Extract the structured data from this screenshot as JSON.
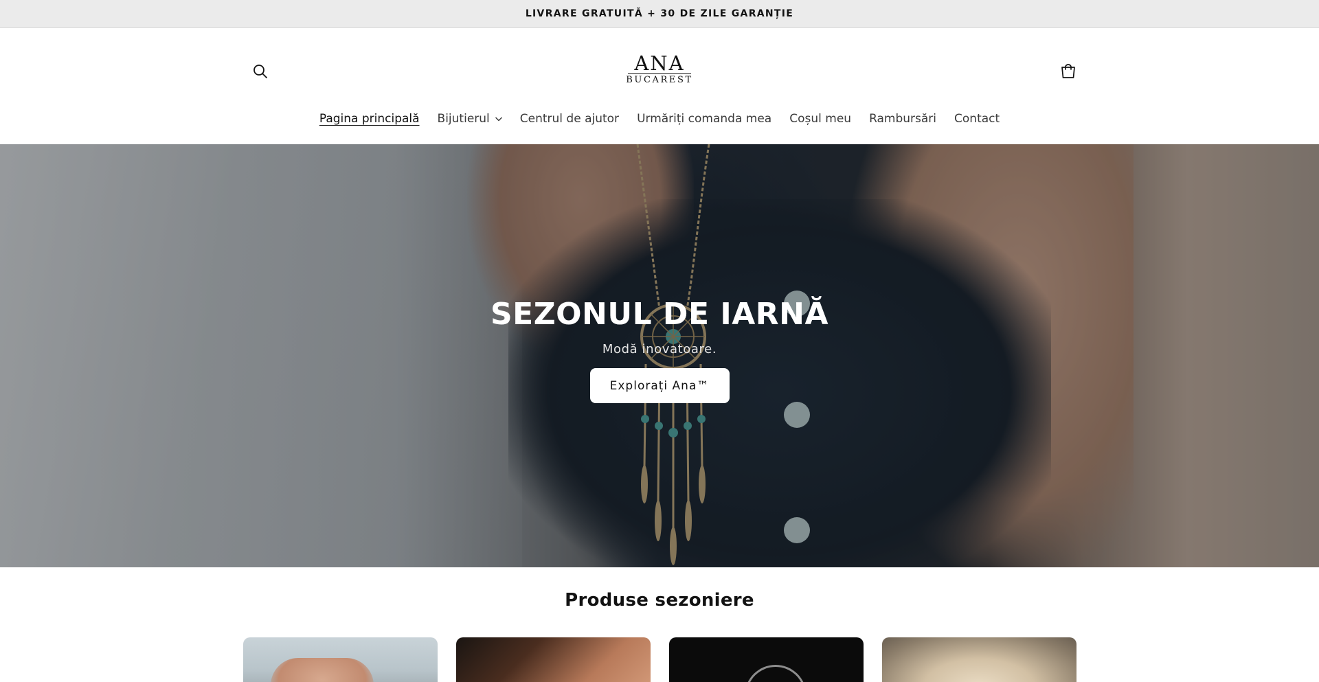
{
  "announcement": {
    "text": "LIVRARE GRATUITĂ + 30 DE ZILE GARANȚIE"
  },
  "header": {
    "logo_top": "ANA",
    "logo_bottom": "BUCAREST",
    "search_icon": "search-icon",
    "cart_icon": "cart-icon"
  },
  "nav": {
    "items": [
      {
        "label": "Pagina principală",
        "active": true
      },
      {
        "label": "Bijutierul",
        "has_dropdown": true
      },
      {
        "label": "Centrul de ajutor"
      },
      {
        "label": "Urmăriți comanda mea"
      },
      {
        "label": "Coșul meu"
      },
      {
        "label": "Rambursări"
      },
      {
        "label": "Contact"
      }
    ]
  },
  "hero": {
    "title": "SEZONUL DE IARNĂ",
    "subtitle": "Modă inovatoare.",
    "button_label": "Explorați Ana™"
  },
  "featured": {
    "title": "Produse sezoniere"
  },
  "colors": {
    "announcement_bg": "#ebebeb",
    "text": "#121212",
    "hero_button_bg": "#ffffff"
  }
}
